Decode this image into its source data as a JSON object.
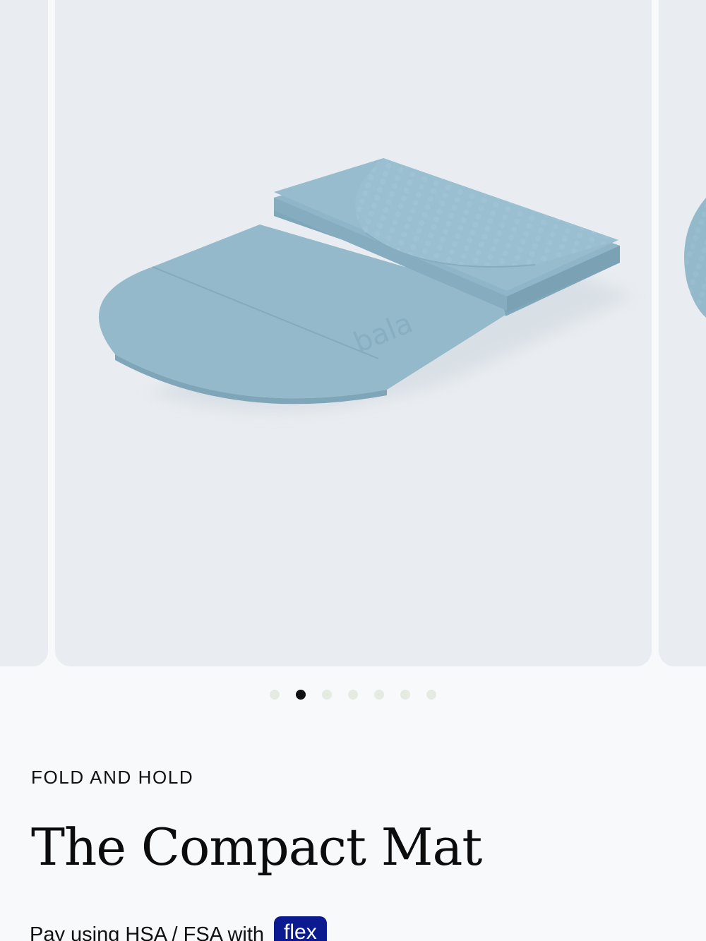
{
  "carousel": {
    "product_image_icon": "folded-mat-image",
    "embossed_logo": "bala",
    "dots_count": 7,
    "active_dot": 2,
    "colors": {
      "slide_bg": "#e9edf1",
      "mat": "#93b9cb",
      "dot_inactive": "#e6ebe2",
      "dot_active": "#111111"
    }
  },
  "product": {
    "eyebrow": "FOLD AND HOLD",
    "title": "The Compact Mat",
    "pay_text": "Pay using HSA / FSA with",
    "pay_badge": "flex",
    "badge_color": "#0b1a8f"
  }
}
